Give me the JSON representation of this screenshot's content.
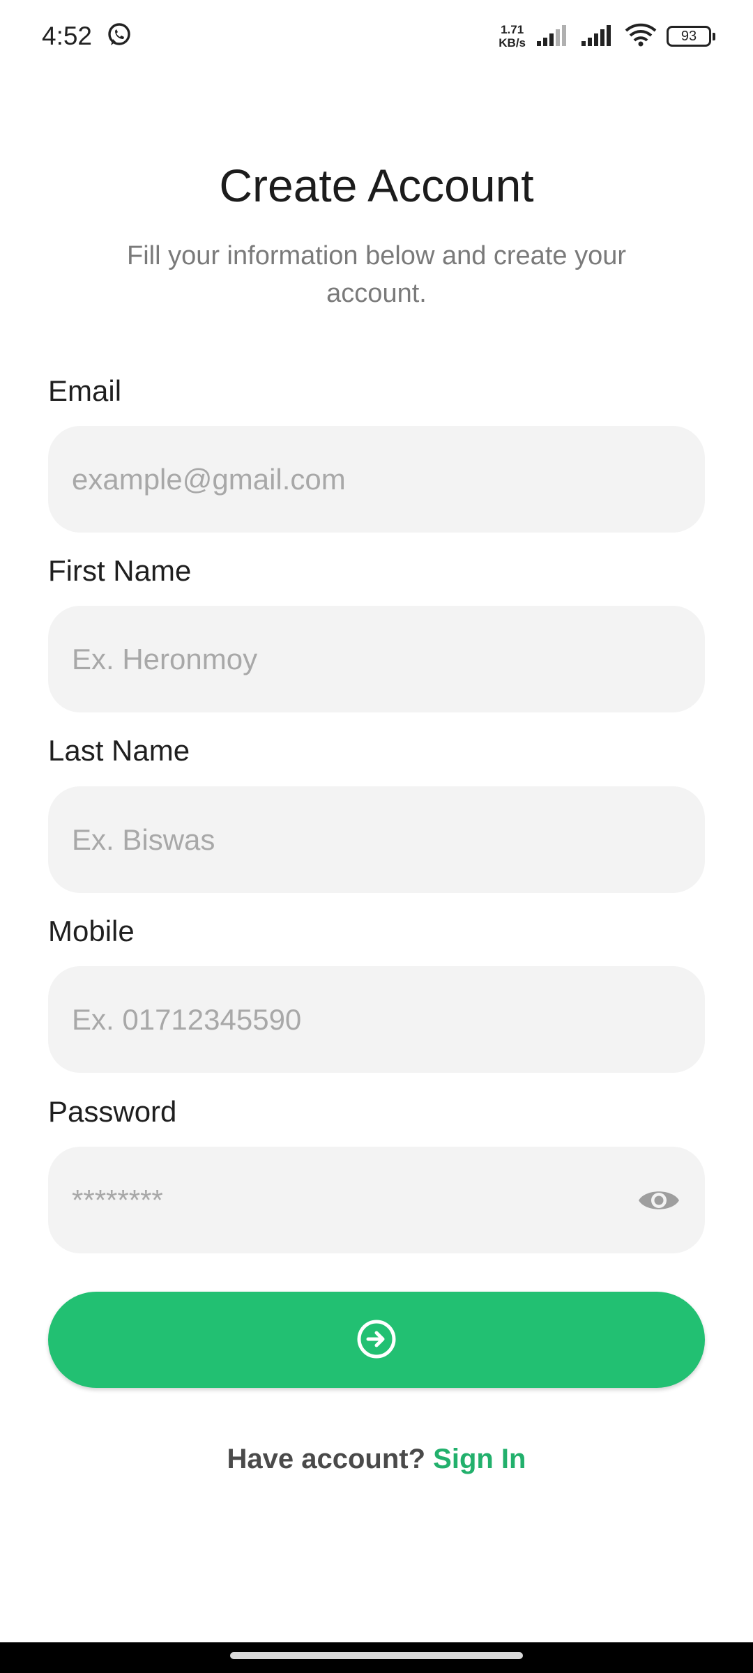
{
  "status_bar": {
    "time": "4:52",
    "net_speed_value": "1.71",
    "net_speed_unit": "KB/s",
    "battery": "93"
  },
  "header": {
    "title": "Create Account",
    "subtitle": "Fill your information below and create your account."
  },
  "form": {
    "email": {
      "label": "Email",
      "placeholder": "example@gmail.com"
    },
    "first_name": {
      "label": "First Name",
      "placeholder": "Ex. Heronmoy"
    },
    "last_name": {
      "label": "Last Name",
      "placeholder": "Ex. Biswas"
    },
    "mobile": {
      "label": "Mobile",
      "placeholder": "Ex. 01712345590"
    },
    "password": {
      "label": "Password",
      "placeholder": "********"
    }
  },
  "footer": {
    "prompt": "Have account? ",
    "link": "Sign In"
  },
  "colors": {
    "accent": "#22c072",
    "link": "#22b06c",
    "field_bg": "#f3f3f3"
  },
  "icons": {
    "submit": "arrow-circle-right-icon",
    "password_toggle": "eye-icon",
    "notification": "whatsapp-icon"
  }
}
